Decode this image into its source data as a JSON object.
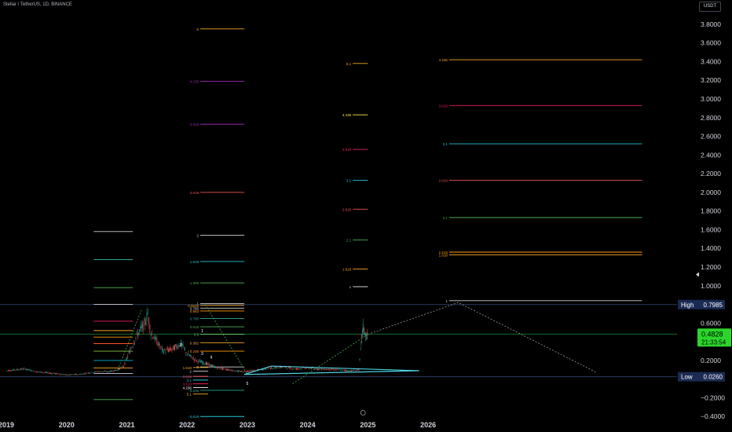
{
  "header": {
    "symbol_title": "Stellar / TetherUS, 1D, BINANCE",
    "currency": "USDT"
  },
  "colors": {
    "background": "#000000",
    "candle_up": "#26a69a",
    "candle_down": "#ef5350",
    "projection_line": "#9e9e9e",
    "triangle": "#4dd0e1",
    "high_badge": "#1a2a52",
    "price_badge": "#2bd62b"
  },
  "price_badges": {
    "high_label": "High",
    "high_value": "0.7985",
    "current_value": "0.4828",
    "countdown": "21:33:54",
    "low_label": "Low",
    "low_value": "0.0260"
  },
  "chart_data": {
    "type": "candlestick",
    "title": "Stellar / TetherUS, 1D, BINANCE",
    "x_ticks": [
      "2019",
      "2020",
      "2021",
      "2022",
      "2023",
      "2024",
      "2025",
      "2026"
    ],
    "y_ticks": [
      "3.8000",
      "3.6000",
      "3.4000",
      "3.2000",
      "3.0000",
      "2.8000",
      "2.6000",
      "2.4000",
      "2.2000",
      "2.0000",
      "1.8000",
      "1.6000",
      "1.4000",
      "1.2000",
      "1.0000",
      "0.8000",
      "0.6000",
      "0.4000",
      "0.2000",
      "0.0000",
      "−0.2000",
      "−0.4000"
    ],
    "y_tick_values": [
      3.8,
      3.6,
      3.4,
      3.2,
      3.0,
      2.8,
      2.6,
      2.4,
      2.2,
      2.0,
      1.8,
      1.6,
      1.4,
      1.2,
      1.0,
      0.8,
      0.6,
      0.4,
      0.2,
      0.0,
      -0.2,
      -0.4
    ],
    "ylim": [
      -0.44,
      4.06
    ],
    "x_range": [
      2019.0,
      2030.0
    ],
    "high": 0.7985,
    "low": 0.026,
    "current": 0.4828,
    "price_path": [
      [
        2019.0,
        0.09
      ],
      [
        2019.3,
        0.11
      ],
      [
        2019.5,
        0.08
      ],
      [
        2019.8,
        0.06
      ],
      [
        2020.0,
        0.045
      ],
      [
        2020.2,
        0.05
      ],
      [
        2020.5,
        0.08
      ],
      [
        2020.7,
        0.08
      ],
      [
        2020.85,
        0.1
      ],
      [
        2020.95,
        0.14
      ],
      [
        2021.05,
        0.3
      ],
      [
        2021.15,
        0.45
      ],
      [
        2021.3,
        0.6
      ],
      [
        2021.35,
        0.7
      ],
      [
        2021.4,
        0.5
      ],
      [
        2021.5,
        0.4
      ],
      [
        2021.6,
        0.3
      ],
      [
        2021.75,
        0.32
      ],
      [
        2021.9,
        0.38
      ],
      [
        2022.0,
        0.27
      ],
      [
        2022.15,
        0.2
      ],
      [
        2022.3,
        0.17
      ],
      [
        2022.5,
        0.12
      ],
      [
        2022.7,
        0.1
      ],
      [
        2022.9,
        0.08
      ],
      [
        2023.1,
        0.09
      ],
      [
        2023.4,
        0.12
      ],
      [
        2023.6,
        0.13
      ],
      [
        2023.8,
        0.11
      ],
      [
        2024.0,
        0.12
      ],
      [
        2024.2,
        0.11
      ],
      [
        2024.5,
        0.1
      ],
      [
        2024.7,
        0.09
      ],
      [
        2024.85,
        0.1
      ],
      [
        2024.88,
        0.3
      ],
      [
        2024.9,
        0.45
      ],
      [
        2024.92,
        0.55
      ],
      [
        2024.95,
        0.5
      ],
      [
        2024.98,
        0.45
      ],
      [
        2025.0,
        0.48
      ]
    ],
    "fibonacci_sets": [
      {
        "name": "",
        "x_range": [
          2020.45,
          2021.1
        ],
        "levels": [
          {
            "label": "",
            "value": 1.58,
            "color": "#cfcfcf"
          },
          {
            "label": "",
            "value": 1.28,
            "color": "#26a69a"
          },
          {
            "label": "",
            "value": 0.98,
            "color": "#4caf50"
          },
          {
            "label": "",
            "value": 0.8,
            "color": "#cfcfcf"
          },
          {
            "label": "",
            "value": 0.62,
            "color": "#e91e63"
          },
          {
            "label": "",
            "value": 0.52,
            "color": "#f9a825"
          },
          {
            "label": "",
            "value": 0.45,
            "color": "#ff9800"
          },
          {
            "label": "",
            "value": 0.38,
            "color": "#ff5722"
          },
          {
            "label": "",
            "value": 0.3,
            "color": "#8bc34a"
          },
          {
            "label": "",
            "value": 0.2,
            "color": "#00bcd4"
          },
          {
            "label": "",
            "value": 0.12,
            "color": "#f9a825"
          },
          {
            "label": "",
            "value": 0.06,
            "color": "#cfcfcf"
          },
          {
            "label": "",
            "value": -0.22,
            "color": "#4caf50"
          }
        ]
      },
      {
        "name": "",
        "x_range": [
          2022.22,
          2022.95
        ],
        "levels": [
          {
            "label": "5",
            "value": 3.75,
            "color": "#f9a825"
          },
          {
            "label": "4.236",
            "value": 3.19,
            "color": "#9c27b0"
          },
          {
            "label": "3.618",
            "value": 2.73,
            "color": "#9c27b0"
          },
          {
            "label": "2.618",
            "value": 2.0,
            "color": "#ef5350"
          },
          {
            "label": "2",
            "value": 1.54,
            "color": "#cfcfcf"
          },
          {
            "label": "1.618",
            "value": 1.26,
            "color": "#26c6da"
          },
          {
            "label": "1.309",
            "value": 1.03,
            "color": "#4caf50"
          },
          {
            "label": "1",
            "value": 0.81,
            "color": "#cfcfcf"
          },
          {
            "label": "0.9045",
            "value": 0.79,
            "color": "#f9a825"
          },
          {
            "label": "0.786",
            "value": 0.76,
            "color": "#cfcfcf"
          },
          {
            "label": "0.893",
            "value": 0.73,
            "color": "#ff9800"
          },
          {
            "label": "0.786",
            "value": 0.65,
            "color": "#26a69a"
          },
          {
            "label": "0.618",
            "value": 0.56,
            "color": "#4caf50"
          },
          {
            "label": "0.5",
            "value": 0.48,
            "color": "#66bb6a"
          },
          {
            "label": "0.382",
            "value": 0.39,
            "color": "#f9a825"
          },
          {
            "label": "0.236",
            "value": 0.3,
            "color": "#ff9800"
          },
          {
            "label": "0",
            "value": 0.13,
            "color": "#cfcfcf"
          },
          {
            "label": "-0.236",
            "value": -0.12,
            "color": "#26a69a"
          },
          {
            "label": "-0.618",
            "value": -0.4,
            "color": "#26c6da"
          }
        ]
      },
      {
        "name": "",
        "x_range": [
          2022.1,
          2022.35
        ],
        "levels": [
          {
            "label": "1.618",
            "value": 0.125,
            "color": "#f9a825"
          },
          {
            "label": "2",
            "value": 0.085,
            "color": "#cfcfcf"
          },
          {
            "label": "2.618",
            "value": 0.03,
            "color": "#ef5350"
          },
          {
            "label": "3.1",
            "value": -0.01,
            "color": "#26c6da"
          },
          {
            "label": "3.618",
            "value": -0.05,
            "color": "#e91e63"
          },
          {
            "label": "4.236",
            "value": -0.09,
            "color": "#ffffff"
          },
          {
            "label": "5.1",
            "value": -0.16,
            "color": "#f9a825"
          }
        ]
      },
      {
        "name": "",
        "x_range": [
          2024.75,
          2025.0
        ],
        "levels": [
          {
            "label": "5.1",
            "value": 3.38,
            "color": "#f9a825"
          },
          {
            "label": "4.236",
            "value": 2.83,
            "color": "#ffeb3b"
          },
          {
            "label": "3.618",
            "value": 2.46,
            "color": "#e91e63"
          },
          {
            "label": "3.1",
            "value": 2.13,
            "color": "#26c6da"
          },
          {
            "label": "2.618",
            "value": 1.82,
            "color": "#ef5350"
          },
          {
            "label": "2.1",
            "value": 1.49,
            "color": "#4caf50"
          },
          {
            "label": "1.618",
            "value": 1.18,
            "color": "#f9a825"
          },
          {
            "label": "1",
            "value": 0.99,
            "color": "#cfcfcf"
          }
        ]
      },
      {
        "name": "",
        "x_range": [
          2026.35,
          2029.55
        ],
        "levels": [
          {
            "label": "4.236",
            "value": 3.42,
            "color": "#f9a825"
          },
          {
            "label": "3.618",
            "value": 2.93,
            "color": "#e91e63"
          },
          {
            "label": "3.1",
            "value": 2.52,
            "color": "#26c6da"
          },
          {
            "label": "2.618",
            "value": 2.13,
            "color": "#ef5350"
          },
          {
            "label": "2.1",
            "value": 1.73,
            "color": "#4caf50"
          },
          {
            "label": "1.618",
            "value": 1.36,
            "color": "#ff9800"
          },
          {
            "label": "1.618",
            "value": 1.33,
            "color": "#f9a825"
          },
          {
            "label": "1",
            "value": 0.84,
            "color": "#cfcfcf"
          }
        ]
      }
    ],
    "wave_labels": [
      {
        "label": "1",
        "x": 2022.25,
        "y": 0.5
      },
      {
        "label": "2",
        "x": 2021.9,
        "y": 0.35
      },
      {
        "label": "3",
        "x": 2022.25,
        "y": 0.26
      },
      {
        "label": "4",
        "x": 2022.4,
        "y": 0.22
      },
      {
        "label": "5",
        "x": 2023.0,
        "y": -0.06
      }
    ],
    "projections": [
      {
        "points": [
          [
            2020.85,
            0.1
          ],
          [
            2021.25,
            0.75
          ]
        ],
        "color": "#4caf50"
      },
      {
        "points": [
          [
            2022.3,
            0.8
          ],
          [
            2023.0,
            0.05
          ]
        ],
        "color": "#4caf50"
      },
      {
        "points": [
          [
            2025.0,
            0.48
          ],
          [
            2026.5,
            0.82
          ],
          [
            2028.8,
            0.07
          ]
        ],
        "color": "#9e9e9e"
      },
      {
        "points": [
          [
            2023.75,
            -0.05
          ],
          [
            2025.0,
            0.48
          ]
        ],
        "color": "#4caf50"
      }
    ],
    "triangle": [
      [
        2023.4,
        0.14
      ],
      [
        2025.85,
        0.09
      ],
      [
        2022.95,
        0.05
      ]
    ]
  }
}
